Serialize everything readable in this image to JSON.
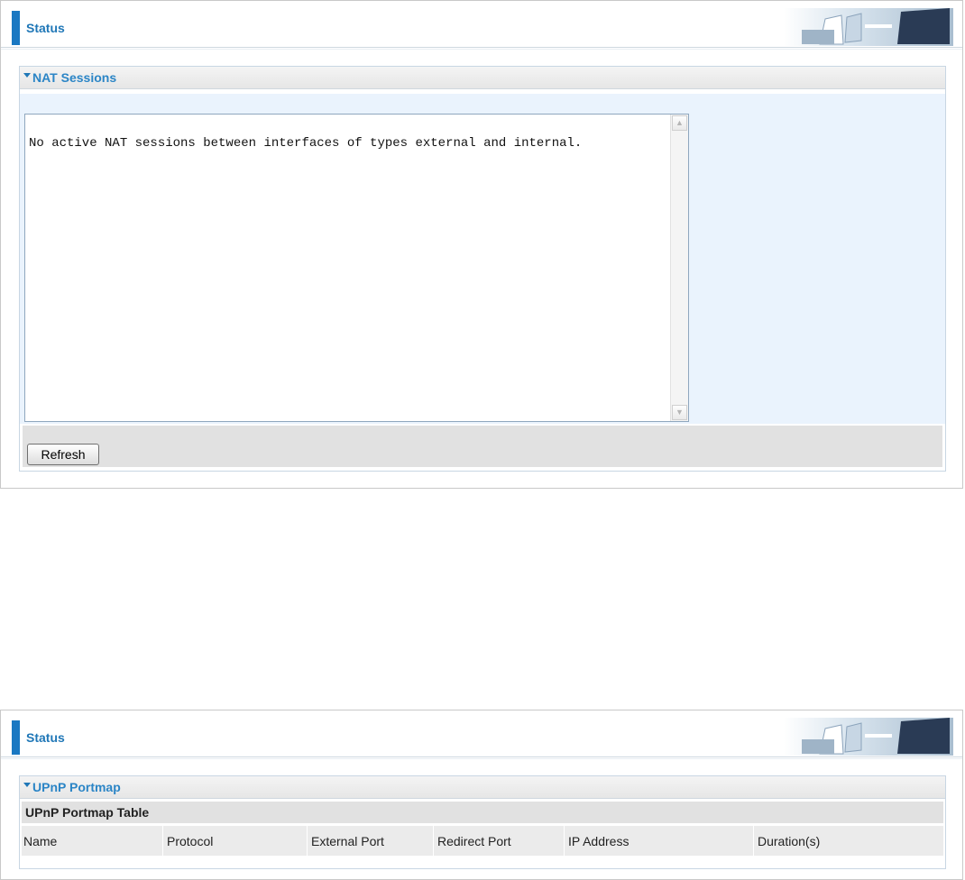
{
  "panel1": {
    "header": {
      "title": "Status"
    },
    "section": {
      "title": "NAT Sessions",
      "textarea_content": "No active NAT sessions between interfaces of types external and internal.",
      "refresh_label": "Refresh"
    }
  },
  "panel2": {
    "header": {
      "title": "Status"
    },
    "section": {
      "title": "UPnP Portmap",
      "table_title": "UPnP Portmap Table",
      "columns": [
        "Name",
        "Protocol",
        "External Port",
        "Redirect Port",
        "IP Address",
        "Duration(s)"
      ]
    }
  },
  "colors": {
    "accent": "#1a78c2",
    "section_title": "#2b85c6",
    "panel_body": "#eaf3fd",
    "button_bar": "#e1e1e1"
  },
  "icons": {
    "banner": "office-chairs-banner-icon",
    "section_toggle": "triangle-down-icon",
    "scroll_up": "scroll-up-arrow-icon",
    "scroll_down": "scroll-down-arrow-icon"
  }
}
